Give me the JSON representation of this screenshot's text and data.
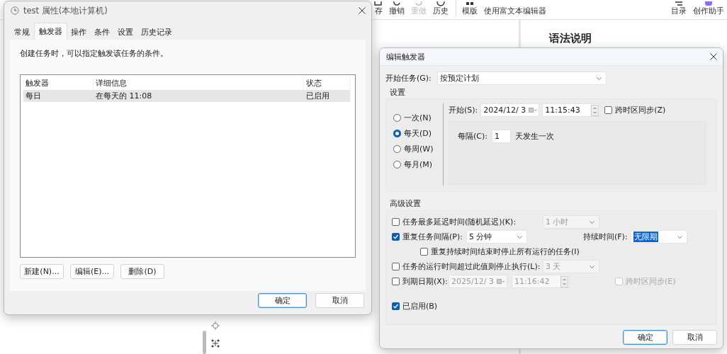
{
  "background": {
    "toolbar_groups": [
      {
        "items": [
          {
            "label": "存",
            "disabled": false
          },
          {
            "label": "撤销",
            "disabled": false
          },
          {
            "label": "重做",
            "disabled": true
          },
          {
            "label": "历史",
            "disabled": false
          }
        ]
      },
      {
        "items": [
          {
            "label": "模版",
            "disabled": false
          },
          {
            "label": "使用富文本编辑器",
            "disabled": false
          }
        ]
      },
      {
        "items": [
          {
            "label": "目录",
            "disabled": false
          },
          {
            "label": "创作助手",
            "disabled": false
          }
        ]
      }
    ],
    "heading": "语法说明"
  },
  "properties_dialog": {
    "title": "test 属性(本地计算机)",
    "tabs": [
      {
        "label": "常规",
        "selected": false
      },
      {
        "label": "触发器",
        "selected": true
      },
      {
        "label": "操作",
        "selected": false
      },
      {
        "label": "条件",
        "selected": false
      },
      {
        "label": "设置",
        "selected": false
      },
      {
        "label": "历史记录",
        "selected": false
      }
    ],
    "description": "创建任务时，可以指定触发该任务的条件。",
    "trigger_list": {
      "columns": [
        "触发器",
        "详细信息",
        "状态"
      ],
      "rows": [
        {
          "cells": [
            "每日",
            "在每天的 11:08",
            "已启用"
          ],
          "selected": true
        }
      ]
    },
    "list_buttons": [
      "新建(N)...",
      "编辑(E)...",
      "删除(D)"
    ],
    "buttons": [
      {
        "label": "确定",
        "default": true
      },
      {
        "label": "取消",
        "default": false
      }
    ]
  },
  "edit_trigger_dialog": {
    "title": "编辑触发器",
    "begin": {
      "label": "开始任务(G):",
      "value": "按预定计划"
    },
    "settings": {
      "title": "设置",
      "schedules": [
        {
          "label": "一次(N)",
          "selected": false
        },
        {
          "label": "每天(D)",
          "selected": true
        },
        {
          "label": "每周(W)",
          "selected": false
        },
        {
          "label": "每月(M)",
          "selected": false
        }
      ],
      "start": {
        "label": "开始(S):",
        "date": "2024/12/ 3",
        "time": "11:15:43",
        "sync": {
          "label": "跨时区同步(Z)",
          "checked": false
        }
      },
      "recur": {
        "label": "每隔(C):",
        "value": "1",
        "suffix": "天发生一次"
      }
    },
    "advanced": {
      "title": "高级设置",
      "delay": {
        "label": "任务最多延迟时间(随机延迟)(K):",
        "checked": false,
        "value": "1 小时"
      },
      "repeat": {
        "label": "重复任务间隔(P):",
        "checked": true,
        "value": "5 分钟",
        "duration": {
          "label": "持续时间(F):",
          "value": "无限期",
          "highlighted": true
        }
      },
      "stop_at_end": {
        "label": "重复持续时间结束时停止所有运行的任务(I)",
        "checked": false
      },
      "stop_after": {
        "label": "任务的运行时间超过此值则停止执行(L):",
        "checked": false,
        "value": "3 天"
      },
      "expire": {
        "label": "到期日期(X):",
        "checked": false,
        "date": "2025/12/ 3",
        "time": "11:16:42",
        "sync": {
          "label": "跨时区同步(E)",
          "checked": false
        }
      },
      "enabled": {
        "label": "已启用(B)",
        "checked": true
      }
    },
    "buttons": [
      {
        "label": "确定",
        "default": true
      },
      {
        "label": "取消",
        "default": false
      }
    ]
  }
}
